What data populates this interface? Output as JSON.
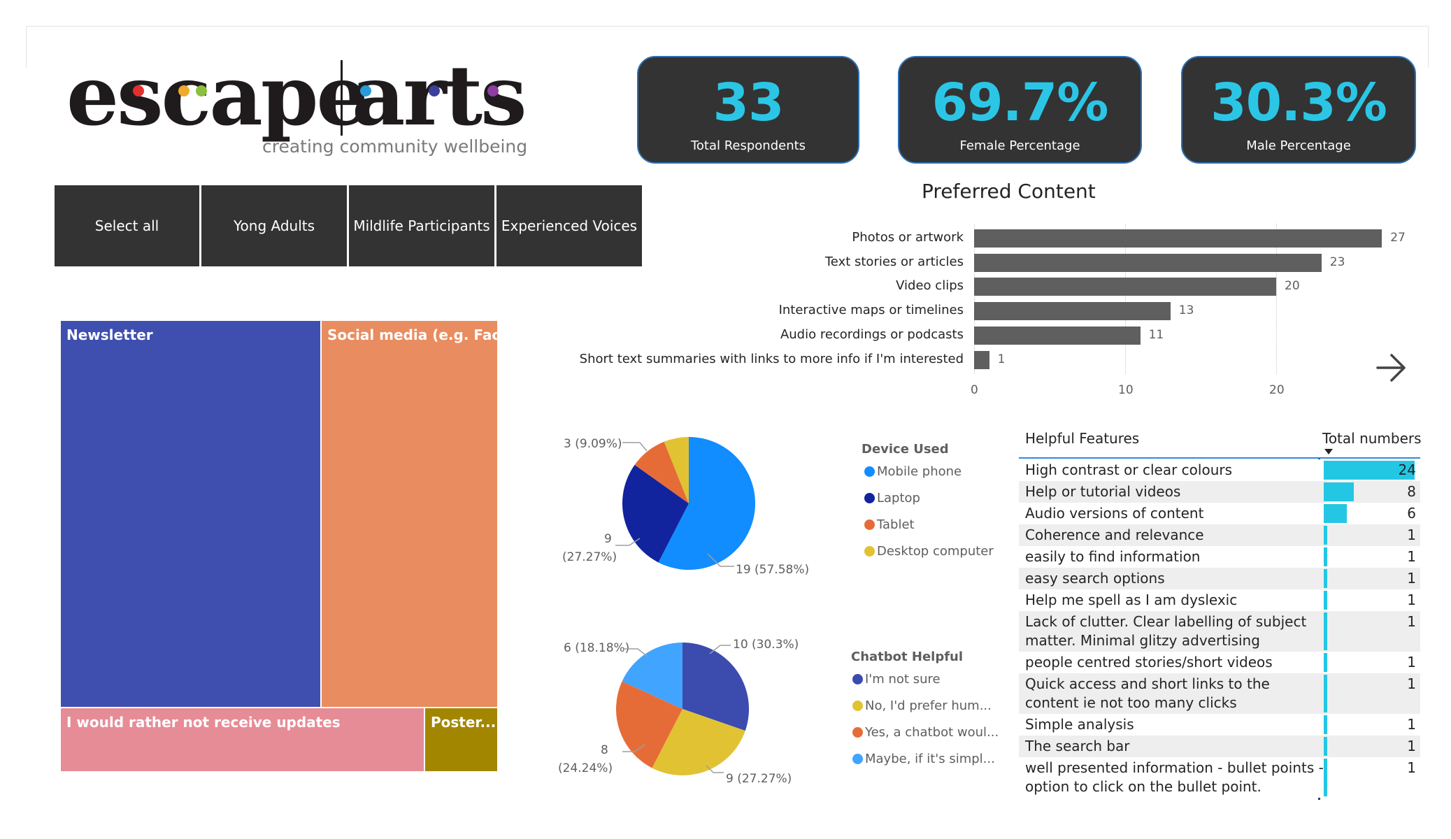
{
  "brand": {
    "logo_left": "escape",
    "logo_right": "arts",
    "tagline": "creating community wellbeing",
    "dot_colors": [
      "#e52f2f",
      "#f0a92b",
      "#8bbf3d",
      "#2b9ad8",
      "#3b3f9c",
      "#8e3ea0"
    ]
  },
  "kpis": [
    {
      "value": "33",
      "label": "Total Respondents"
    },
    {
      "value": "69.7%",
      "label": "Female Percentage"
    },
    {
      "value": "30.3%",
      "label": "Male Percentage"
    }
  ],
  "slicer": {
    "buttons": [
      "Select all",
      "Yong Adults",
      "Mildlife Participants",
      "Experienced Voices"
    ]
  },
  "treemap": {
    "cells": [
      {
        "label": "Newsletter",
        "color": "#3f4fb0"
      },
      {
        "label": "Social media (e.g. Fac...",
        "color": "#e98c5f"
      },
      {
        "label": "I would rather not receive updates",
        "color": "#e68c96"
      },
      {
        "label": "Poster...",
        "color": "#a38600"
      }
    ]
  },
  "preferred_content": {
    "title": "Preferred Content",
    "nav_icon": "arrow-right-icon",
    "chart_data": {
      "type": "bar",
      "orientation": "horizontal",
      "categories": [
        "Photos or artwork",
        "Text stories or articles",
        "Video clips",
        "Interactive maps or timelines",
        "Audio recordings or podcasts",
        "Short text summaries with links to more info if I'm interested"
      ],
      "values": [
        27,
        23,
        20,
        13,
        11,
        1
      ],
      "xticks": [
        "0",
        "10",
        "20"
      ],
      "xlim": [
        0,
        30
      ],
      "grid": true,
      "bar_color": "#5f5f5f"
    }
  },
  "device_used": {
    "legend_title": "Device Used",
    "chart_data": {
      "type": "pie",
      "categories": [
        "Mobile phone",
        "Laptop",
        "Tablet",
        "Desktop computer"
      ],
      "values": [
        19,
        9,
        3,
        2
      ],
      "colors": [
        "#118dff",
        "#12239e",
        "#e66c37",
        "#e1c233"
      ],
      "labels": [
        "19 (57.58%)",
        "9\n(27.27%)",
        "3 (9.09%)",
        ""
      ]
    }
  },
  "chatbot_helpful": {
    "legend_title": "Chatbot Helpful",
    "chart_data": {
      "type": "pie",
      "categories": [
        "I'm not sure",
        "No, I'd prefer hum...",
        "Yes, a chatbot woul...",
        "Maybe, if it's simpl..."
      ],
      "values": [
        10,
        9,
        8,
        6
      ],
      "colors": [
        "#3c4bae",
        "#e1c233",
        "#e66c37",
        "#41a4ff"
      ],
      "labels": [
        "10 (30.3%)",
        "9 (27.27%)",
        "8\n(24.24%)",
        "6 (18.18%)"
      ]
    }
  },
  "helpful_features": {
    "col_feature": "Helpful Features",
    "col_total": "Total numbers",
    "sort_icon": "sort-descending-icon",
    "max": 24,
    "rows": [
      {
        "feature": "High contrast or clear colours",
        "total": "24",
        "value": 24
      },
      {
        "feature": "Help or tutorial videos",
        "total": "8",
        "value": 8
      },
      {
        "feature": "Audio versions of content",
        "total": "6",
        "value": 6
      },
      {
        "feature": "Coherence and relevance",
        "total": "1",
        "value": 1
      },
      {
        "feature": "easily to find information",
        "total": "1",
        "value": 1
      },
      {
        "feature": "easy search options",
        "total": "1",
        "value": 1
      },
      {
        "feature": "Help me spell as I am dyslexic",
        "total": "1",
        "value": 1
      },
      {
        "feature": "Lack of clutter. Clear labelling of subject matter. Minimal glitzy advertising",
        "total": "1",
        "value": 1
      },
      {
        "feature": "people centred stories/short videos",
        "total": "1",
        "value": 1
      },
      {
        "feature": "Quick access and short links to the content ie not too many clicks",
        "total": "1",
        "value": 1
      },
      {
        "feature": "Simple analysis",
        "total": "1",
        "value": 1
      },
      {
        "feature": "The search bar",
        "total": "1",
        "value": 1
      },
      {
        "feature": "well presented information - bullet points - option to click on the bullet point.",
        "total": "1",
        "value": 1
      }
    ]
  }
}
